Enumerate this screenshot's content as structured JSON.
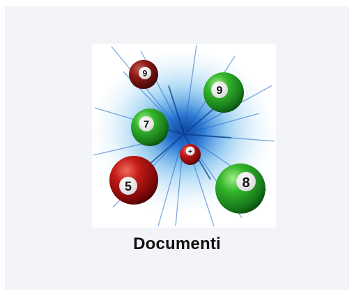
{
  "tile": {
    "label": "Documenti",
    "icon": "lottery-balls-burst-icon",
    "balls": [
      {
        "number": "9",
        "color": "dark-red"
      },
      {
        "number": "9",
        "color": "green"
      },
      {
        "number": "7",
        "color": "green"
      },
      {
        "number": "+",
        "color": "red"
      },
      {
        "number": "5",
        "color": "red"
      },
      {
        "number": "8",
        "color": "green"
      }
    ]
  },
  "colors": {
    "background": "#f3f4f8",
    "text": "#111111",
    "burst": "#2f8fd8",
    "ball_red": "#a10f10",
    "ball_green": "#22a023"
  }
}
